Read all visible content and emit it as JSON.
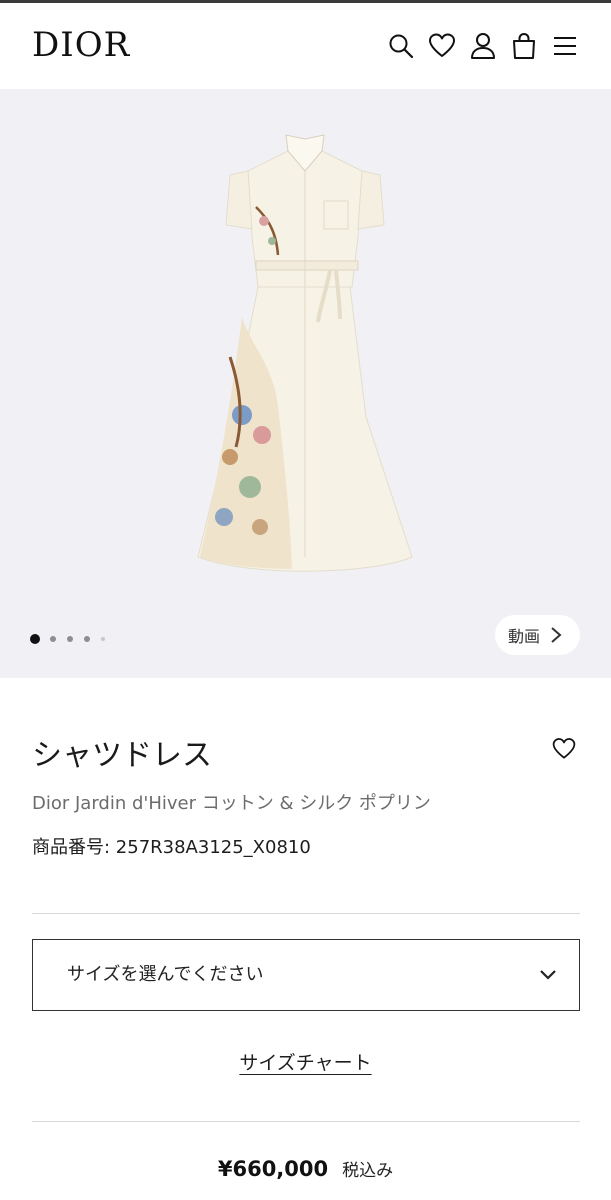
{
  "header": {
    "logo": "DIOR",
    "icons": [
      "search-icon",
      "heart-icon",
      "user-icon",
      "bag-icon",
      "menu-icon"
    ]
  },
  "gallery": {
    "image_count": 5,
    "active_index": 0,
    "video_label": "動画"
  },
  "product": {
    "title": "シャツドレス",
    "subtitle": "Dior Jardin d'Hiver コットン & シルク ポプリン",
    "sku": "商品番号: 257R38A3125_X0810",
    "size_placeholder": "サイズを選んでください",
    "size_chart_label": "サイズチャート",
    "price": "¥660,000",
    "tax_label": "税込み"
  },
  "colors": {
    "gallery_bg": "#f1f0f5",
    "dress": "#f7f2e6",
    "button": "#3b2f2a",
    "text": "#222222"
  }
}
